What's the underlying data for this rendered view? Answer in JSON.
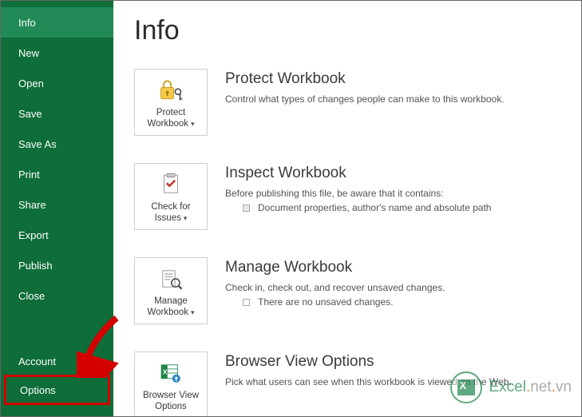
{
  "sidebar": {
    "items": [
      {
        "label": "Info",
        "active": true,
        "highlighted": false
      },
      {
        "label": "New",
        "active": false,
        "highlighted": false
      },
      {
        "label": "Open",
        "active": false,
        "highlighted": false
      },
      {
        "label": "Save",
        "active": false,
        "highlighted": false
      },
      {
        "label": "Save As",
        "active": false,
        "highlighted": false
      },
      {
        "label": "Print",
        "active": false,
        "highlighted": false
      },
      {
        "label": "Share",
        "active": false,
        "highlighted": false
      },
      {
        "label": "Export",
        "active": false,
        "highlighted": false
      },
      {
        "label": "Publish",
        "active": false,
        "highlighted": false
      },
      {
        "label": "Close",
        "active": false,
        "highlighted": false
      }
    ],
    "lower_items": [
      {
        "label": "Account",
        "highlighted": false
      },
      {
        "label": "Options",
        "highlighted": true
      }
    ]
  },
  "page": {
    "title": "Info"
  },
  "sections": [
    {
      "tile_label": "Protect Workbook",
      "tile_icon": "lock-key",
      "has_caret": true,
      "title": "Protect Workbook",
      "desc": "Control what types of changes people can make to this workbook.",
      "sublines": []
    },
    {
      "tile_label": "Check for Issues",
      "tile_icon": "check-doc",
      "has_caret": true,
      "title": "Inspect Workbook",
      "desc": "Before publishing this file, be aware that it contains:",
      "sublines": [
        {
          "icon": "square",
          "text": "Document properties, author's name and absolute path"
        }
      ]
    },
    {
      "tile_label": "Manage Workbook",
      "tile_icon": "manage-doc",
      "has_caret": true,
      "title": "Manage Workbook",
      "desc": "Check in, check out, and recover unsaved changes.",
      "sublines": [
        {
          "icon": "doc-outline",
          "text": "There are no unsaved changes."
        }
      ]
    },
    {
      "tile_label": "Browser View Options",
      "tile_icon": "browser-view",
      "has_caret": false,
      "title": "Browser View Options",
      "desc": "Pick what users can see when this workbook is viewed on the Web.",
      "sublines": []
    }
  ],
  "watermark": {
    "text_main": "Excel",
    "text_dot": ".",
    "text_net": "net",
    "text_dot2": ".",
    "text_tld": "vn"
  }
}
